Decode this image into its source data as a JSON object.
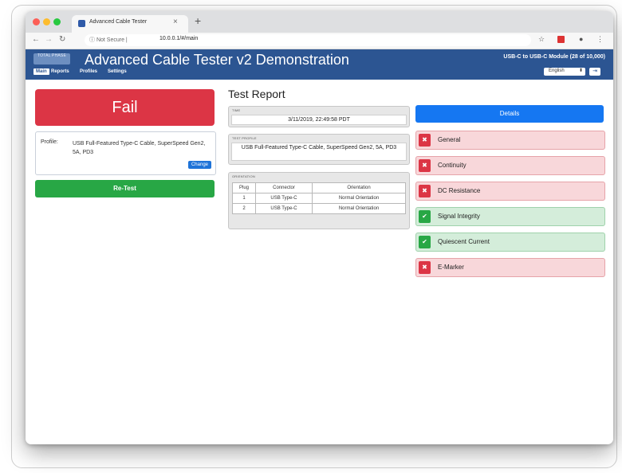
{
  "browser": {
    "tab_title": "Advanced Cable Tester",
    "tab_close": "×",
    "new_tab": "+",
    "security": "Not Secure",
    "url": "10.0.0.1/#/main"
  },
  "header": {
    "logo_text": "TOTAL PHASE",
    "title": "Advanced Cable Tester v2 Demonstration",
    "module": "USB-C to USB-C Module (28 of 10,000)",
    "menu": [
      "Main",
      "Reports",
      "Profiles",
      "Settings"
    ],
    "language": "English"
  },
  "left": {
    "status": "Fail",
    "profile_label": "Profile:",
    "profile_value": "USB Full-Featured Type-C Cable, SuperSpeed Gen2, 5A, PD3",
    "change_label": "Change",
    "retest_label": "Re-Test"
  },
  "report": {
    "title": "Test Report",
    "time_label": "TIME",
    "time_value": "3/11/2019, 22:49:58 PDT",
    "profile_label": "TEST PROFILE",
    "profile_value": "USB Full-Featured Type-C Cable, SuperSpeed Gen2, 5A, PD3",
    "orientation_label": "ORIENTATION",
    "columns": [
      "Plug",
      "Connector",
      "Orientation"
    ],
    "rows": [
      [
        "1",
        "USB Type-C",
        "Normal Orientation"
      ],
      [
        "2",
        "USB Type-C",
        "Normal Orientation"
      ]
    ]
  },
  "results": {
    "details_label": "Details",
    "items": [
      {
        "label": "General",
        "status": "fail"
      },
      {
        "label": "Continuity",
        "status": "fail"
      },
      {
        "label": "DC Resistance",
        "status": "fail"
      },
      {
        "label": "Signal Integrity",
        "status": "pass"
      },
      {
        "label": "Quiescent Current",
        "status": "pass"
      },
      {
        "label": "E-Marker",
        "status": "fail"
      }
    ]
  },
  "colors": {
    "header": "#2c5592",
    "fail": "#dc3545",
    "pass": "#28a745",
    "details": "#1577f2"
  }
}
